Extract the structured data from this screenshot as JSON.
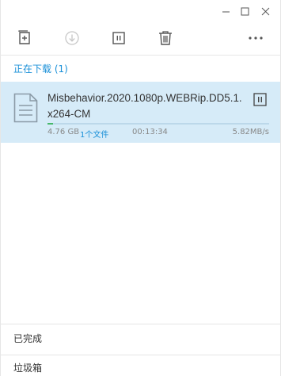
{
  "window": {
    "minimize_glyph": "—",
    "maximize_glyph": "☐",
    "close_glyph": "✕"
  },
  "toolbar": {
    "new_icon": "new-task-icon",
    "download_icon": "download-icon",
    "pause_icon": "pause-icon",
    "delete_icon": "delete-icon",
    "more_glyph": "•••"
  },
  "downloading": {
    "title": "正在下载 (1)"
  },
  "item": {
    "name": "Misbehavior.2020.1080p.WEBRip.DD5.1.x264-CM",
    "size": "4.76 GB",
    "files": "1个文件",
    "time": "00:13:34",
    "speed": "5.82MB/s",
    "progress_fraction": 0.024
  },
  "footer": {
    "completed": "已完成",
    "trash": "垃圾箱"
  },
  "colors": {
    "accent": "#1a90d8",
    "selected_row": "#d6ebf8",
    "progress": "#46b86a"
  }
}
